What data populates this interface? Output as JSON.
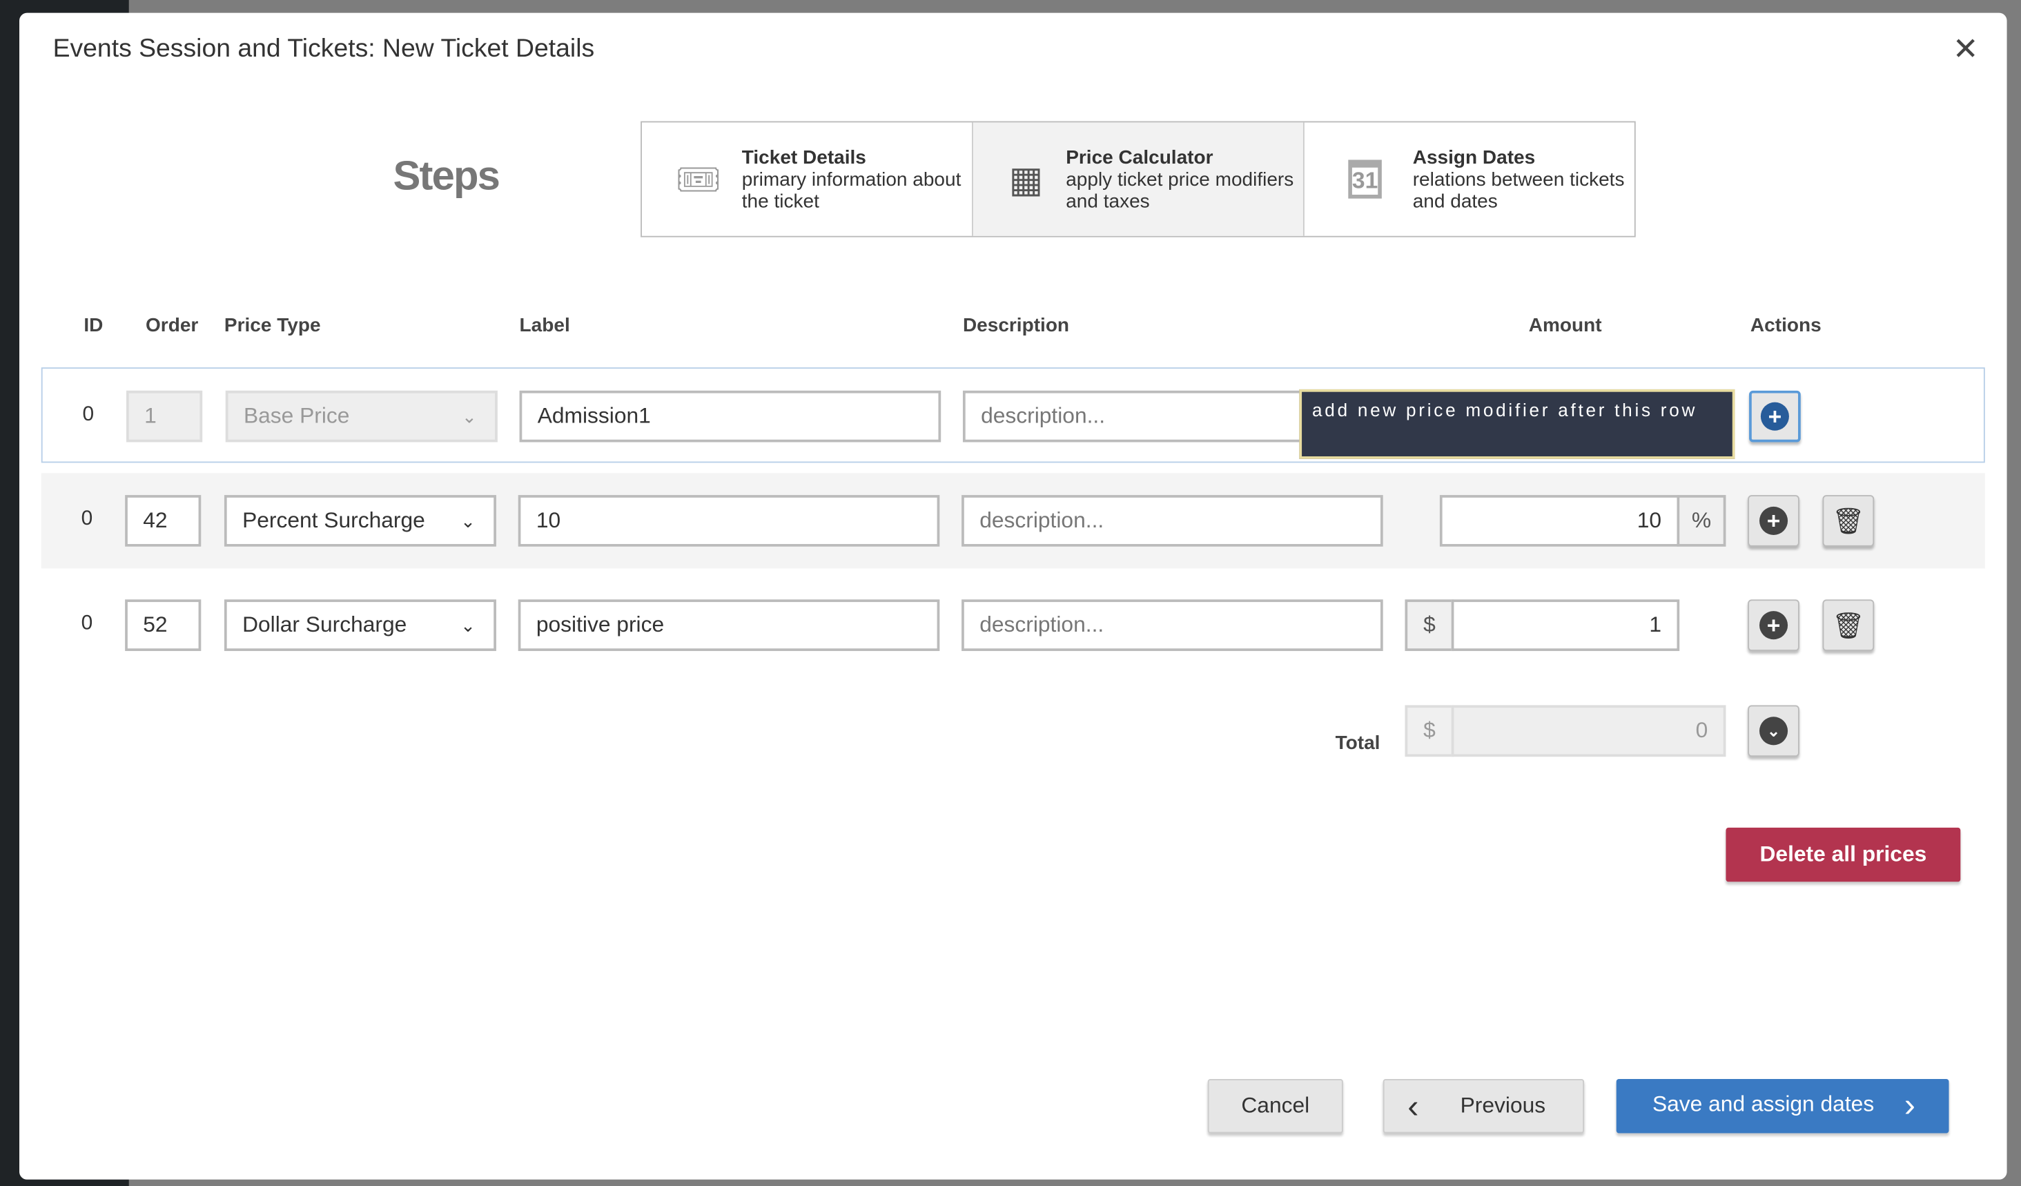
{
  "modal": {
    "title": "Events Session and Tickets: New Ticket Details",
    "close_icon": "close-icon"
  },
  "steps": {
    "label": "Steps",
    "items": [
      {
        "title": "Ticket Details",
        "desc": "primary information about the ticket",
        "icon": "ticket-icon",
        "active": false
      },
      {
        "title": "Price Calculator",
        "desc": "apply ticket price modifiers and taxes",
        "icon": "calculator-icon",
        "active": true
      },
      {
        "title": "Assign Dates",
        "desc": "relations between tickets and dates",
        "icon": "calendar-icon",
        "icon_text": "31",
        "active": false
      }
    ]
  },
  "table": {
    "headers": {
      "id": "ID",
      "order": "Order",
      "price_type": "Price Type",
      "label": "Label",
      "description": "Description",
      "amount": "Amount",
      "actions": "Actions"
    },
    "rows": [
      {
        "id": "0",
        "order": "1",
        "price_type": "Base Price",
        "label": "Admission1",
        "description_placeholder": "description...",
        "amount": ""
      },
      {
        "id": "0",
        "order": "42",
        "price_type": "Percent Surcharge",
        "label": "10",
        "description_placeholder": "description...",
        "amount": "10",
        "unit": "%"
      },
      {
        "id": "0",
        "order": "52",
        "price_type": "Dollar Surcharge",
        "label": "positive price",
        "description_placeholder": "description...",
        "amount": "1",
        "unit": "$"
      }
    ],
    "total": {
      "label": "Total",
      "currency": "$",
      "value": "0"
    }
  },
  "tooltip": "add new price modifier after this row",
  "buttons": {
    "delete_all": "Delete all prices",
    "cancel": "Cancel",
    "previous": "Previous",
    "save": "Save and assign dates"
  },
  "colors": {
    "primary": "#3a7ac3",
    "danger": "#b3344f",
    "tooltip_bg": "#313849"
  }
}
